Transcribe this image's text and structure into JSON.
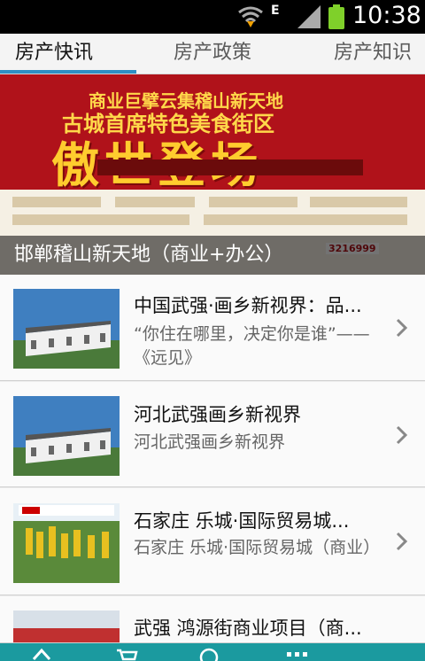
{
  "status_bar": {
    "time": "10:38",
    "network": "E",
    "icons": [
      "wifi-icon",
      "signal-icon",
      "battery-icon"
    ]
  },
  "tabs": [
    {
      "label": "房产快讯",
      "active": true
    },
    {
      "label": "房产政策",
      "active": false
    },
    {
      "label": "房产知识",
      "active": false
    }
  ],
  "banner": {
    "line1": "商业巨擘云集稽山新天地",
    "line2": "古城首席特色美食街区",
    "headline": "傲世登场",
    "caption": "邯郸稽山新天地（商业+办公）",
    "phone": "3216999"
  },
  "news": [
    {
      "title": "中国武强·画乡新视界：品...",
      "desc": "“你住在哪里，决定你是谁”——《远见》"
    },
    {
      "title": "河北武强画乡新视界",
      "desc": "河北武强画乡新视界"
    },
    {
      "title": "石家庄 乐城·国际贸易城...",
      "desc": "石家庄 乐城·国际贸易城（商业）"
    },
    {
      "title": "武强 鸿源街商业项目（商...",
      "desc": ""
    }
  ],
  "colors": {
    "accent": "#2e8fc4",
    "bottom_bar": "#1b9a9f",
    "banner_red": "#b0121a"
  }
}
